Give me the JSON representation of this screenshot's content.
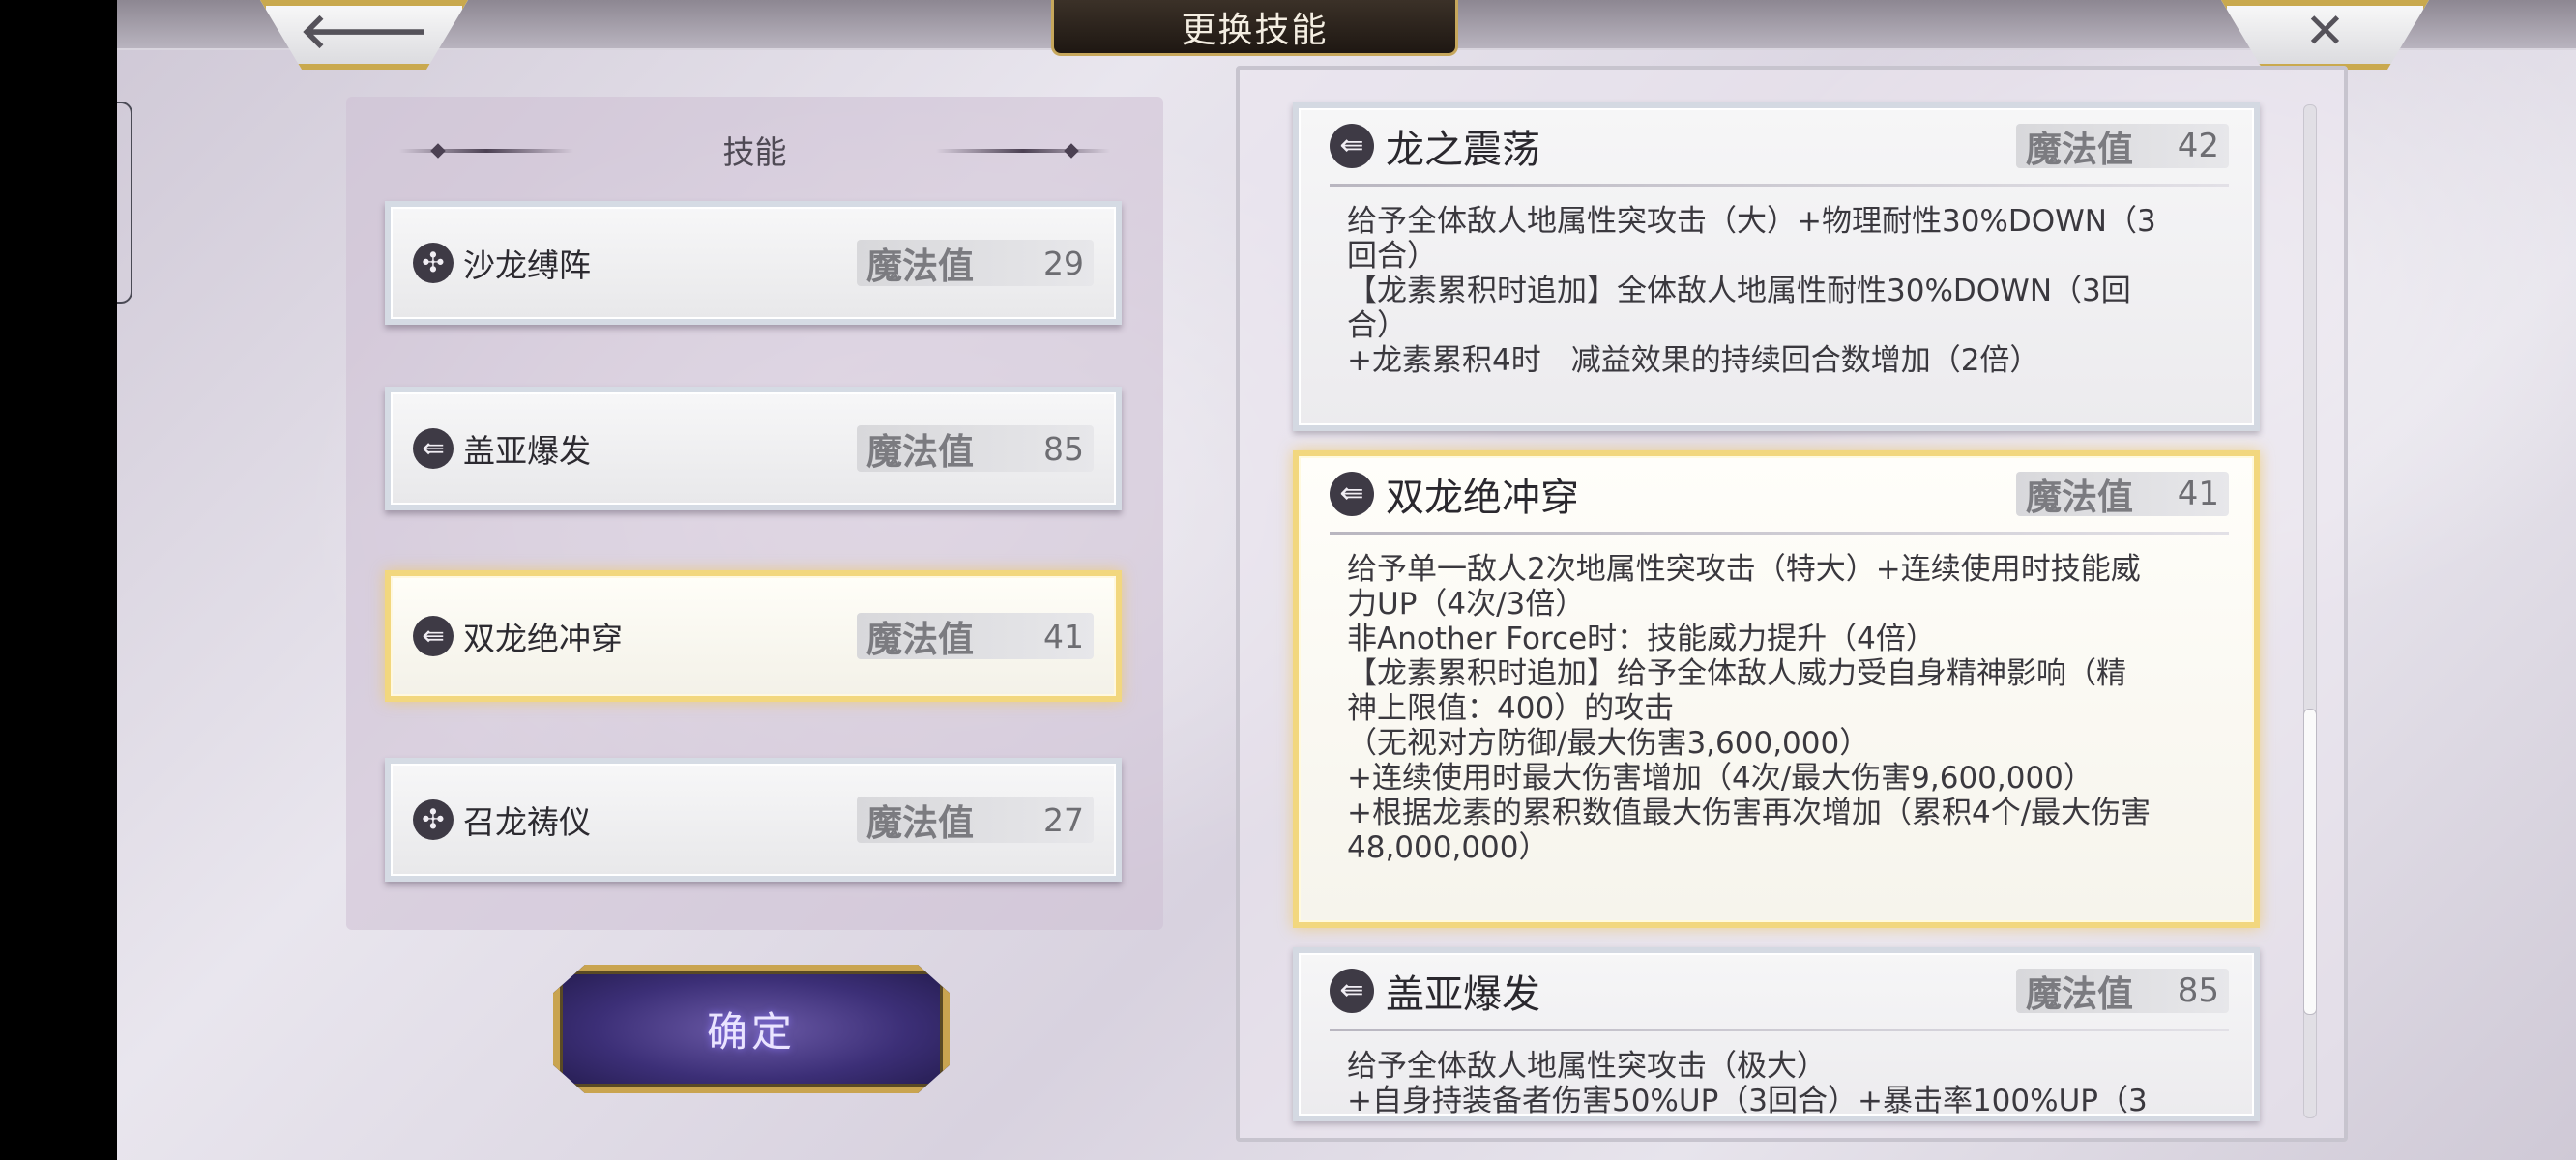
{
  "header": {
    "title": "更换技能",
    "back_glyph": "🡐",
    "close_glyph": "✕"
  },
  "skill_panel": {
    "title": "技能",
    "items": [
      {
        "name": "沙龙缚阵",
        "mp_label": "魔法值",
        "mp": "29",
        "icon": "wind-burst-icon"
      },
      {
        "name": "盖亚爆发",
        "mp_label": "魔法值",
        "mp": "85",
        "icon": "arrow-thrust-icon"
      },
      {
        "name": "双龙绝冲穿",
        "mp_label": "魔法值",
        "mp": "41",
        "icon": "arrow-thrust-icon",
        "selected": true
      },
      {
        "name": "召龙祷仪",
        "mp_label": "魔法值",
        "mp": "27",
        "icon": "wind-burst-icon"
      }
    ],
    "confirm_label": "确定"
  },
  "details": [
    {
      "name": "龙之震荡",
      "mp_label": "魔法值",
      "mp": "42",
      "icon": "arrow-thrust-icon",
      "text": "给予全体敌人地属性突攻击（大）+物理耐性30%DOWN（3\n回合）\n【龙素累积时追加】全体敌人地属性耐性30%DOWN（3回\n合）\n+龙素累积4时　减益效果的持续回合数增加（2倍）"
    },
    {
      "name": "双龙绝冲穿",
      "mp_label": "魔法值",
      "mp": "41",
      "icon": "arrow-thrust-icon",
      "selected": true,
      "text": "给予单一敌人2次地属性突攻击（特大）+连续使用时技能威\n力UP（4次/3倍）\n非Another Force时：技能威力提升（4倍）\n【龙素累积时追加】给予全体敌人威力受自身精神影响（精\n神上限值：400）的攻击\n（无视对方防御/最大伤害3,600,000）\n+连续使用时最大伤害增加（4次/最大伤害9,600,000）\n+根据龙素的累积数值最大伤害再次增加（累积4个/最大伤害\n48,000,000）"
    },
    {
      "name": "盖亚爆发",
      "mp_label": "魔法值",
      "mp": "85",
      "icon": "arrow-thrust-icon",
      "text": "给予全体敌人地属性突攻击（极大）\n+自身持装备者伤害50%UP（3回合）+暴击率100%UP（3"
    }
  ],
  "colors": {
    "selected_border": "#f2d77e",
    "confirm_button": "#3c2f77",
    "title_plate": "#1e1712"
  }
}
